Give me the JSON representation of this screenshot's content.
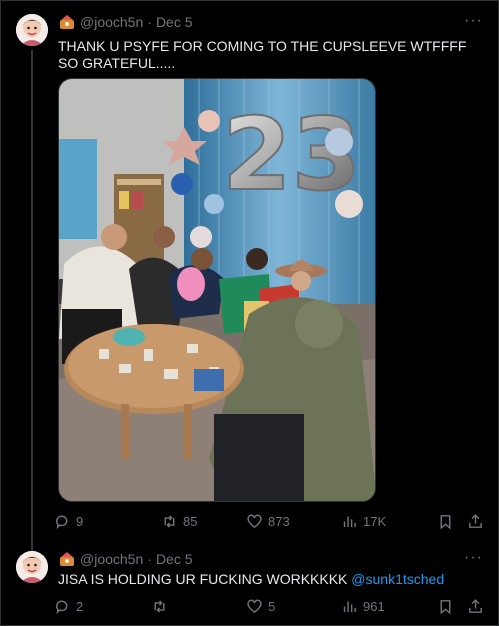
{
  "tweets": [
    {
      "handle": "@jooch5n",
      "sep": "·",
      "date": "Dec 5",
      "more": "···",
      "text": "THANK U PSYFE FOR COMING TO THE CUPSLEEVE WTFFFF SO GRATEFUL.....",
      "media_text": "23",
      "stats": {
        "replies": "9",
        "retweets": "85",
        "likes": "873",
        "views": "17K"
      }
    },
    {
      "handle": "@jooch5n",
      "sep": "·",
      "date": "Dec 5",
      "more": "···",
      "text": "JISA IS HOLDING UR FUCKING WORKKKKK ",
      "mention": "@sunk1tsched",
      "stats": {
        "replies": "2",
        "retweets": "",
        "likes": "5",
        "views": "961"
      }
    }
  ],
  "icons": [
    "reply-icon",
    "retweet-icon",
    "like-icon",
    "views-icon",
    "bookmark-icon",
    "share-icon"
  ],
  "colors": {
    "background": "#000000",
    "text": "#e7e9ea",
    "muted": "#71767b",
    "link": "#1d9bf0",
    "border": "#2f3336"
  }
}
